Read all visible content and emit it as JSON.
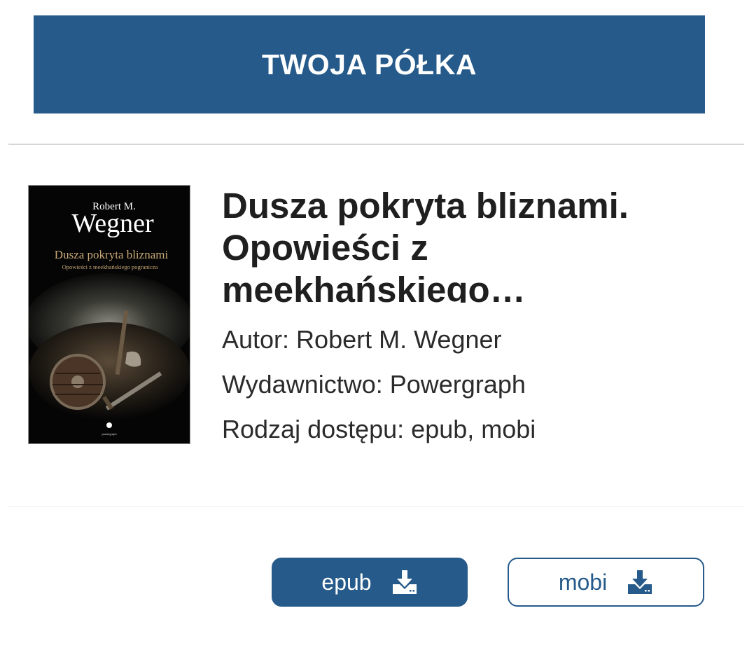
{
  "header": {
    "title": "TWOJA PÓŁKA"
  },
  "book": {
    "title": "Dusza pokryta bliznami. Opowieści z meekhańskiego…",
    "author": "Autor: Robert M. Wegner",
    "publisher": "Wydawnictwo: Powergraph",
    "access": "Rodzaj dostępu: epub, mobi",
    "cover": {
      "author_small": "Robert M.",
      "author_big": "Wegner",
      "title": "Dusza pokryta bliznami",
      "subtitle": "Opowieści z meekhańskiego pogranicza",
      "publisher_logo": "powergraph"
    }
  },
  "downloads": {
    "epub_label": "epub",
    "mobi_label": "mobi",
    "icon": "download-icon"
  },
  "colors": {
    "primary": "#265a8a",
    "text": "#1f1f1f",
    "divider": "#d6d6d6"
  }
}
